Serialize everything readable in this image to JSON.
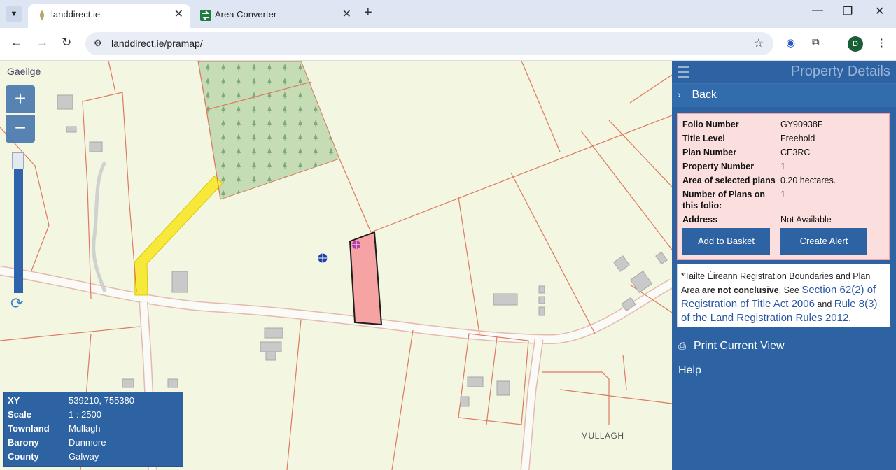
{
  "browser": {
    "tabs": [
      {
        "title": "landdirect.ie",
        "active": true
      },
      {
        "title": "Area Converter",
        "active": false
      }
    ],
    "url": "landdirect.ie/pramap/",
    "profile_initial": "D"
  },
  "map": {
    "language_link": "Gaeilge",
    "zoom_in": "+",
    "zoom_out": "−",
    "place_label": "MULLAGH",
    "info": {
      "xy_label": "XY",
      "xy_value": "539210, 755380",
      "scale_label": "Scale",
      "scale_value": "1 : 2500",
      "townland_label": "Townland",
      "townland_value": "Mullagh",
      "barony_label": "Barony",
      "barony_value": "Dunmore",
      "county_label": "County",
      "county_value": "Galway"
    }
  },
  "panel": {
    "title": "Property Details",
    "back": "Back",
    "details": {
      "folio_label": "Folio Number",
      "folio_value": "GY90938F",
      "title_label": "Title Level",
      "title_value": "Freehold",
      "plan_label": "Plan Number",
      "plan_value": "CE3RC",
      "property_label": "Property Number",
      "property_value": "1",
      "area_label": "Area of selected plans",
      "area_value": "0.20 hectares.",
      "num_plans_label": "Number of Plans on this folio:",
      "num_plans_value": "1",
      "address_label": "Address",
      "address_value": "Not Available"
    },
    "add_to_basket": "Add to Basket",
    "create_alert": "Create Alert",
    "disclaimer": {
      "intro": "*Tailte Éireann Registration Boundaries and Plan Area ",
      "bold": "are not conclusive",
      "see": ". See ",
      "link1": "Section 62(2) of Registration of Title Act 2006",
      "and": " and ",
      "link2": "Rule 8(3) of the Land Registration Rules 2012",
      "end": "."
    },
    "print": "Print Current View",
    "help": "Help"
  },
  "colors": {
    "panel_bg": "#2e63a3",
    "selected_plot": "#f5a3a3",
    "right_of_way": "#f7e93a",
    "forest": "#c6dcb4",
    "map_bg": "#f3f6e1"
  }
}
